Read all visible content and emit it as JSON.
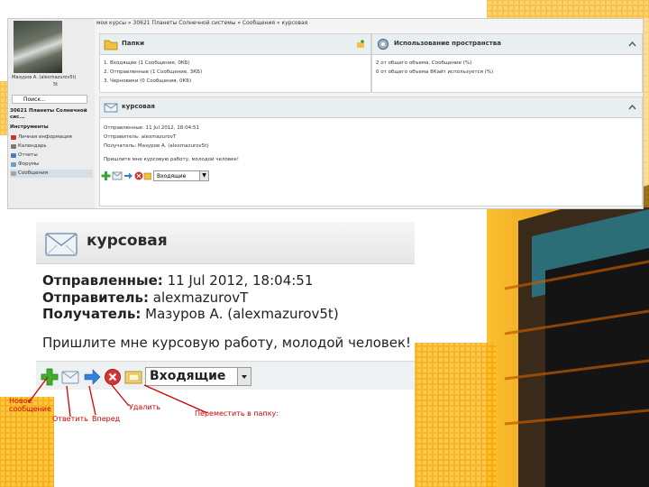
{
  "colors": {
    "accent": "#f5a000",
    "callout": "#d40000",
    "background": "#ffffff"
  },
  "mini": {
    "breadcrumb": "мои курсы » 30621 Планеты Солнечной системы » Сообщения » курсовая",
    "sidebar": {
      "user_name": "Мазуров А. (alexmazurov5t)",
      "status": "5t",
      "search_label": "Поиск...",
      "course_title": "30621 Планеты Солнечной сис...",
      "tools_heading": "Инструменты",
      "items": [
        {
          "label": "Личная информация",
          "icon": "person-icon"
        },
        {
          "label": "Календарь",
          "icon": "calendar-icon"
        },
        {
          "label": "Отчеты",
          "icon": "report-icon"
        },
        {
          "label": "Форумы",
          "icon": "forum-icon"
        },
        {
          "label": "Сообщения",
          "icon": "mail-icon"
        }
      ]
    },
    "folders": {
      "title": "Папки",
      "items": [
        "1. Входящие (1 Сообщение, 0КБ)",
        "2. Отправленные (1 Сообщение, 3КБ)",
        "3. Черновики (0 Сообщения, 0КБ)"
      ]
    },
    "usage": {
      "title": "Использование пространства",
      "items": [
        "2 от общего объема. Сообщение (%)",
        "0 от общего объема 8Кайт используется (%)"
      ]
    },
    "message": {
      "title": "курсовая",
      "sent": "Отправленные: 11 Jul 2012, 18:04:51",
      "sender": "Отправитель: alexmazurovT",
      "recipient": "Получатель: Мазуров А. (alexmazurov5t)",
      "body": "Пришлите мне курсовую работу, молодой человек!",
      "folder_select": "Входящие"
    }
  },
  "zoom": {
    "title": "курсовая",
    "sent_label": "Отправленные:",
    "sent_value": "11 Jul 2012, 18:04:51",
    "sender_label": "Отправитель:",
    "sender_value": "alexmazurovT",
    "recipient_label": "Получатель:",
    "recipient_value": "Мазуров А. (alexmazurov5t)",
    "body": "Пришлите мне курсовую работу, молодой человек!",
    "folder_select": "Входящие",
    "toolbar_icons": [
      "new-message-icon",
      "reply-icon",
      "forward-icon",
      "delete-icon",
      "move-to-folder-icon"
    ]
  },
  "callouts": {
    "new_message_line1": "Новое",
    "new_message_line2": "сообщение",
    "reply": "Ответить",
    "forward": "Вперед",
    "delete": "Удалить",
    "move": "Переместить в папку:"
  }
}
